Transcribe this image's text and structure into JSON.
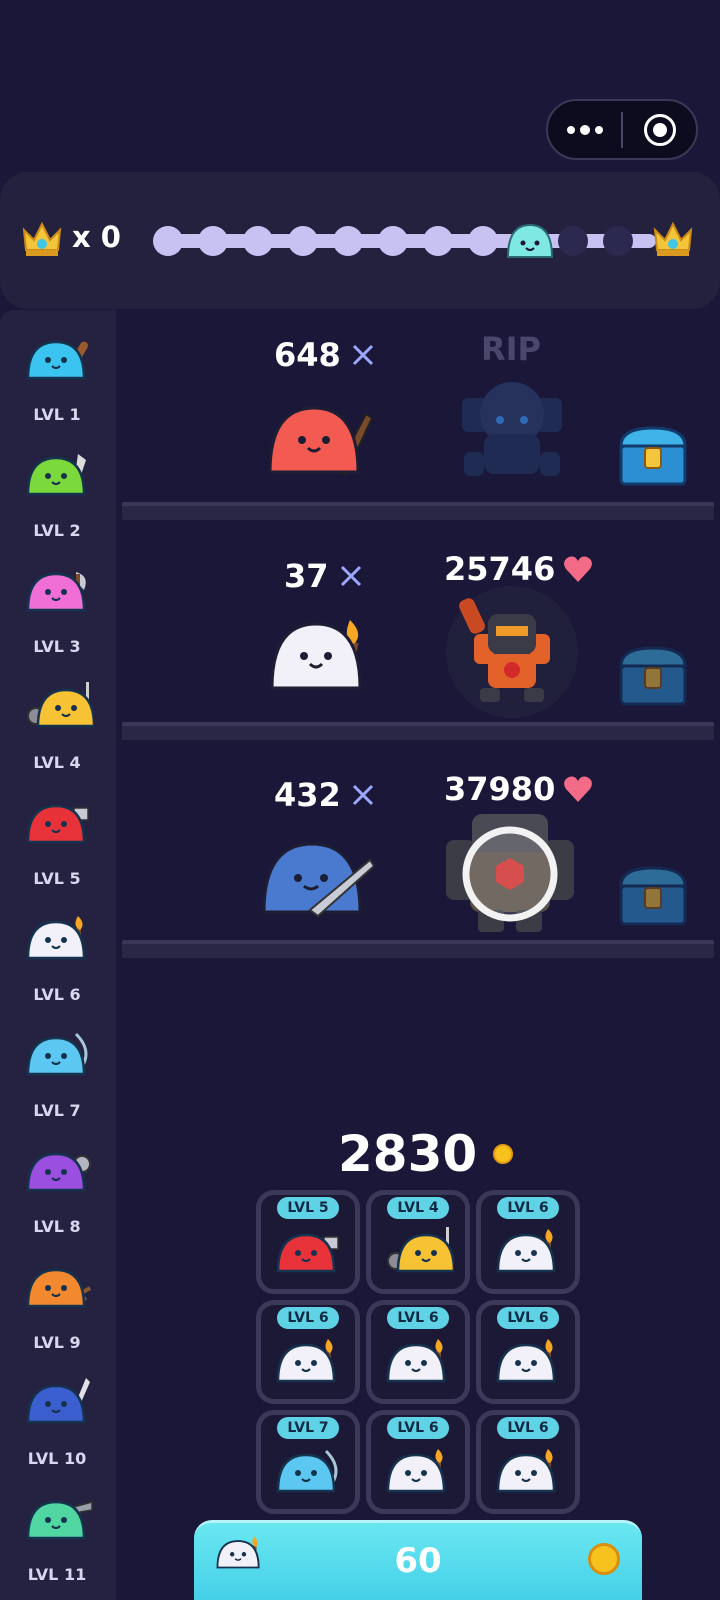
{
  "top_capsule": {
    "more_icon": "more-dots-icon",
    "close_icon": "target-circle-icon"
  },
  "progress": {
    "crown_count": "x 0",
    "stages_total": 11,
    "current_stage": 8,
    "current_slime_color": "#7fe8e2"
  },
  "colors": {
    "background": "#1a1738",
    "panel": "#24213f",
    "accent": "#5fd2e6",
    "heart": "#f46b88",
    "coin": "#f7c11e"
  },
  "sidebar": {
    "items": [
      {
        "label": "LVL 1",
        "color": "#3bc4ef",
        "weapon": "club"
      },
      {
        "label": "LVL 2",
        "color": "#7bd93c",
        "weapon": "knife"
      },
      {
        "label": "LVL 3",
        "color": "#ef6fd6",
        "weapon": "axe"
      },
      {
        "label": "LVL 4",
        "color": "#f7c233",
        "weapon": "spear"
      },
      {
        "label": "LVL 5",
        "color": "#e8323a",
        "weapon": "hammer"
      },
      {
        "label": "LVL 6",
        "color": "#f2f0f8",
        "weapon": "torch"
      },
      {
        "label": "LVL 7",
        "color": "#5cc7f0",
        "weapon": "bow"
      },
      {
        "label": "LVL 8",
        "color": "#9a4fe0",
        "weapon": "flail"
      },
      {
        "label": "LVL 9",
        "color": "#f2892e",
        "weapon": "crossbow"
      },
      {
        "label": "LVL 10",
        "color": "#3c5fd0",
        "weapon": "sword"
      },
      {
        "label": "LVL 11",
        "color": "#4fd6a1",
        "weapon": "pistol"
      }
    ]
  },
  "lanes": [
    {
      "damage": "648",
      "slime_color": "#f35a52",
      "weapon": "shotgun",
      "boss_status": "RIP",
      "chest_active": true
    },
    {
      "damage": "37",
      "slime_color": "#f2f0f8",
      "weapon": "torch",
      "boss_hp": "25746",
      "chest_active": false
    },
    {
      "damage": "432",
      "slime_color": "#4a7ad0",
      "weapon": "rifle",
      "boss_hp": "37980",
      "chest_active": false
    }
  ],
  "coins": "2830",
  "merge_grid": [
    {
      "label": "LVL 5",
      "color": "#e8323a",
      "weapon": "hammer"
    },
    {
      "label": "LVL 4",
      "color": "#f7c233",
      "weapon": "spear"
    },
    {
      "label": "LVL 6",
      "color": "#f2f0f8",
      "weapon": "torch"
    },
    {
      "label": "LVL 6",
      "color": "#f2f0f8",
      "weapon": "torch"
    },
    {
      "label": "LVL 6",
      "color": "#f2f0f8",
      "weapon": "torch"
    },
    {
      "label": "LVL 6",
      "color": "#f2f0f8",
      "weapon": "torch"
    },
    {
      "label": "LVL 7",
      "color": "#5cc7f0",
      "weapon": "bow"
    },
    {
      "label": "LVL 6",
      "color": "#f2f0f8",
      "weapon": "torch"
    },
    {
      "label": "LVL 6",
      "color": "#f2f0f8",
      "weapon": "torch"
    }
  ],
  "buy": {
    "price": "60",
    "icon": "coin-icon"
  }
}
